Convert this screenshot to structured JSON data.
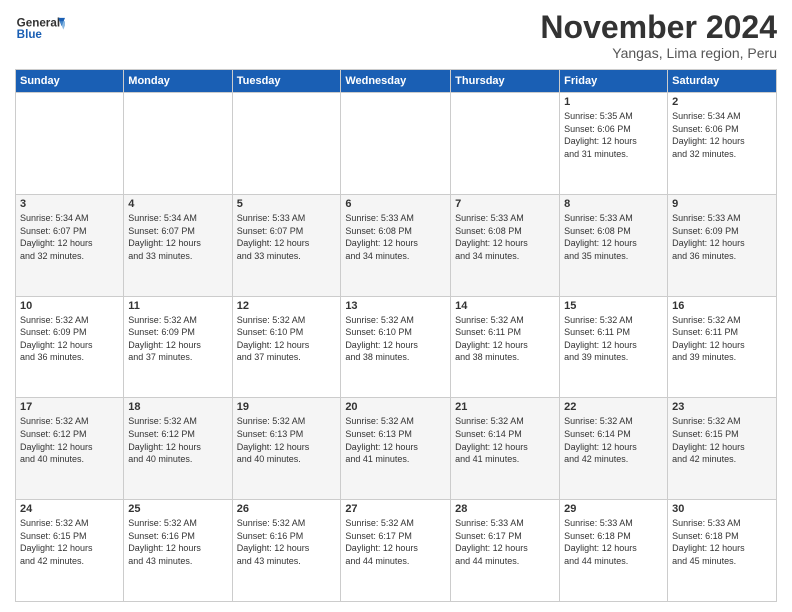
{
  "header": {
    "logo_general": "General",
    "logo_blue": "Blue",
    "month_title": "November 2024",
    "location": "Yangas, Lima region, Peru"
  },
  "days_of_week": [
    "Sunday",
    "Monday",
    "Tuesday",
    "Wednesday",
    "Thursday",
    "Friday",
    "Saturday"
  ],
  "weeks": [
    {
      "days": [
        {
          "num": "",
          "info": ""
        },
        {
          "num": "",
          "info": ""
        },
        {
          "num": "",
          "info": ""
        },
        {
          "num": "",
          "info": ""
        },
        {
          "num": "",
          "info": ""
        },
        {
          "num": "1",
          "info": "Sunrise: 5:35 AM\nSunset: 6:06 PM\nDaylight: 12 hours\nand 31 minutes."
        },
        {
          "num": "2",
          "info": "Sunrise: 5:34 AM\nSunset: 6:06 PM\nDaylight: 12 hours\nand 32 minutes."
        }
      ]
    },
    {
      "days": [
        {
          "num": "3",
          "info": "Sunrise: 5:34 AM\nSunset: 6:07 PM\nDaylight: 12 hours\nand 32 minutes."
        },
        {
          "num": "4",
          "info": "Sunrise: 5:34 AM\nSunset: 6:07 PM\nDaylight: 12 hours\nand 33 minutes."
        },
        {
          "num": "5",
          "info": "Sunrise: 5:33 AM\nSunset: 6:07 PM\nDaylight: 12 hours\nand 33 minutes."
        },
        {
          "num": "6",
          "info": "Sunrise: 5:33 AM\nSunset: 6:08 PM\nDaylight: 12 hours\nand 34 minutes."
        },
        {
          "num": "7",
          "info": "Sunrise: 5:33 AM\nSunset: 6:08 PM\nDaylight: 12 hours\nand 34 minutes."
        },
        {
          "num": "8",
          "info": "Sunrise: 5:33 AM\nSunset: 6:08 PM\nDaylight: 12 hours\nand 35 minutes."
        },
        {
          "num": "9",
          "info": "Sunrise: 5:33 AM\nSunset: 6:09 PM\nDaylight: 12 hours\nand 36 minutes."
        }
      ]
    },
    {
      "days": [
        {
          "num": "10",
          "info": "Sunrise: 5:32 AM\nSunset: 6:09 PM\nDaylight: 12 hours\nand 36 minutes."
        },
        {
          "num": "11",
          "info": "Sunrise: 5:32 AM\nSunset: 6:09 PM\nDaylight: 12 hours\nand 37 minutes."
        },
        {
          "num": "12",
          "info": "Sunrise: 5:32 AM\nSunset: 6:10 PM\nDaylight: 12 hours\nand 37 minutes."
        },
        {
          "num": "13",
          "info": "Sunrise: 5:32 AM\nSunset: 6:10 PM\nDaylight: 12 hours\nand 38 minutes."
        },
        {
          "num": "14",
          "info": "Sunrise: 5:32 AM\nSunset: 6:11 PM\nDaylight: 12 hours\nand 38 minutes."
        },
        {
          "num": "15",
          "info": "Sunrise: 5:32 AM\nSunset: 6:11 PM\nDaylight: 12 hours\nand 39 minutes."
        },
        {
          "num": "16",
          "info": "Sunrise: 5:32 AM\nSunset: 6:11 PM\nDaylight: 12 hours\nand 39 minutes."
        }
      ]
    },
    {
      "days": [
        {
          "num": "17",
          "info": "Sunrise: 5:32 AM\nSunset: 6:12 PM\nDaylight: 12 hours\nand 40 minutes."
        },
        {
          "num": "18",
          "info": "Sunrise: 5:32 AM\nSunset: 6:12 PM\nDaylight: 12 hours\nand 40 minutes."
        },
        {
          "num": "19",
          "info": "Sunrise: 5:32 AM\nSunset: 6:13 PM\nDaylight: 12 hours\nand 40 minutes."
        },
        {
          "num": "20",
          "info": "Sunrise: 5:32 AM\nSunset: 6:13 PM\nDaylight: 12 hours\nand 41 minutes."
        },
        {
          "num": "21",
          "info": "Sunrise: 5:32 AM\nSunset: 6:14 PM\nDaylight: 12 hours\nand 41 minutes."
        },
        {
          "num": "22",
          "info": "Sunrise: 5:32 AM\nSunset: 6:14 PM\nDaylight: 12 hours\nand 42 minutes."
        },
        {
          "num": "23",
          "info": "Sunrise: 5:32 AM\nSunset: 6:15 PM\nDaylight: 12 hours\nand 42 minutes."
        }
      ]
    },
    {
      "days": [
        {
          "num": "24",
          "info": "Sunrise: 5:32 AM\nSunset: 6:15 PM\nDaylight: 12 hours\nand 42 minutes."
        },
        {
          "num": "25",
          "info": "Sunrise: 5:32 AM\nSunset: 6:16 PM\nDaylight: 12 hours\nand 43 minutes."
        },
        {
          "num": "26",
          "info": "Sunrise: 5:32 AM\nSunset: 6:16 PM\nDaylight: 12 hours\nand 43 minutes."
        },
        {
          "num": "27",
          "info": "Sunrise: 5:32 AM\nSunset: 6:17 PM\nDaylight: 12 hours\nand 44 minutes."
        },
        {
          "num": "28",
          "info": "Sunrise: 5:33 AM\nSunset: 6:17 PM\nDaylight: 12 hours\nand 44 minutes."
        },
        {
          "num": "29",
          "info": "Sunrise: 5:33 AM\nSunset: 6:18 PM\nDaylight: 12 hours\nand 44 minutes."
        },
        {
          "num": "30",
          "info": "Sunrise: 5:33 AM\nSunset: 6:18 PM\nDaylight: 12 hours\nand 45 minutes."
        }
      ]
    }
  ]
}
